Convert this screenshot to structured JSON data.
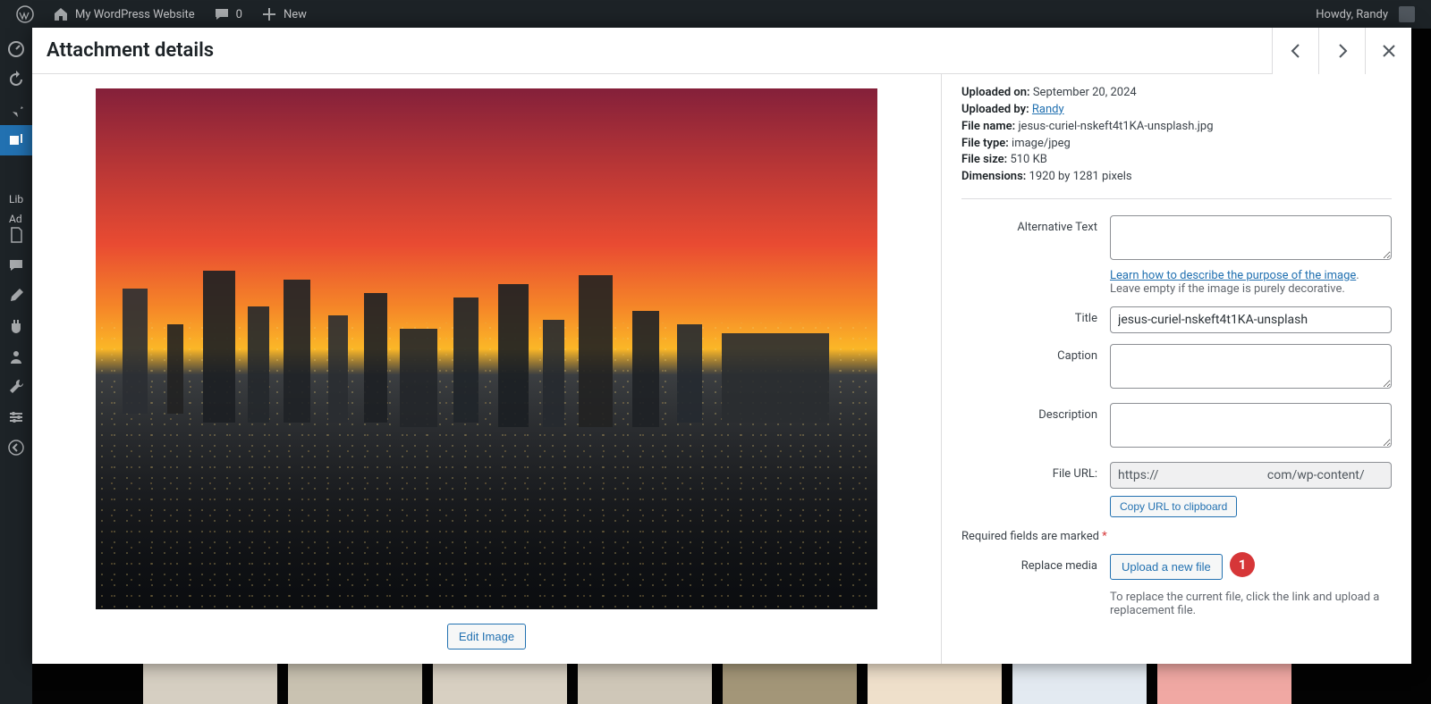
{
  "topbar": {
    "site_name": "My WordPress Website",
    "comments_count": "0",
    "new_label": "New",
    "howdy_label": "Howdy, Randy"
  },
  "sidebar": {
    "submenu": {
      "library": "Lib",
      "add": "Ad"
    }
  },
  "modal": {
    "title": "Attachment details"
  },
  "meta": {
    "uploaded_on_label": "Uploaded on:",
    "uploaded_on_value": "September 20, 2024",
    "uploaded_by_label": "Uploaded by:",
    "uploaded_by_value": "Randy",
    "file_name_label": "File name:",
    "file_name_value": "jesus-curiel-nskeft4t1KA-unsplash.jpg",
    "file_type_label": "File type:",
    "file_type_value": "image/jpeg",
    "file_size_label": "File size:",
    "file_size_value": "510 KB",
    "dimensions_label": "Dimensions:",
    "dimensions_value": "1920 by 1281 pixels"
  },
  "fields": {
    "alt_text_label": "Alternative Text",
    "alt_hint_link": "Learn how to describe the purpose of the image",
    "alt_hint_rest": ". Leave empty if the image is purely decorative.",
    "title_label": "Title",
    "title_value": "jesus-curiel-nskeft4t1KA-unsplash",
    "caption_label": "Caption",
    "description_label": "Description",
    "file_url_label": "File URL:",
    "file_url_value": "https://                                   com/wp-content/",
    "copy_url_label": "Copy URL to clipboard",
    "replace_media_label": "Replace media",
    "upload_new_label": "Upload a new file",
    "replace_hint": "To replace the current file, click the link and upload a replacement file."
  },
  "required_note": "Required fields are marked",
  "edit_image_label": "Edit Image",
  "callout_1": "1"
}
